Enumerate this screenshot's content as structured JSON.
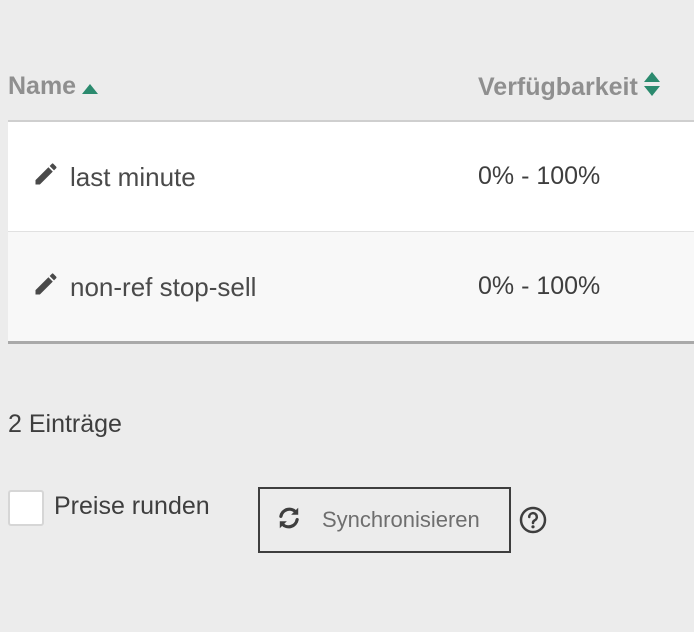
{
  "table": {
    "columns": [
      {
        "label": "Name",
        "sort": "ascending"
      },
      {
        "label": "Verfügbarkeit",
        "sort": "none"
      }
    ],
    "rows": [
      {
        "name": "last minute",
        "availability": "0% - 100%"
      },
      {
        "name": "non-ref stop-sell",
        "availability": "0% - 100%"
      }
    ]
  },
  "footer": {
    "count": "2 Einträge",
    "round_prices_label": "Preise runden",
    "round_prices_checked": false,
    "sync_label": "Synchronisieren"
  },
  "icons": {
    "edit": "pencil-icon",
    "sort_asc": "sort-up-icon",
    "sort_both": "sort-icon",
    "sync": "refresh-icon",
    "help": "question-circle-icon"
  },
  "colors": {
    "accent": "#2b8a6e",
    "background": "#ececec",
    "text": "#3e3e3e",
    "header_text": "#8f8f8f"
  }
}
